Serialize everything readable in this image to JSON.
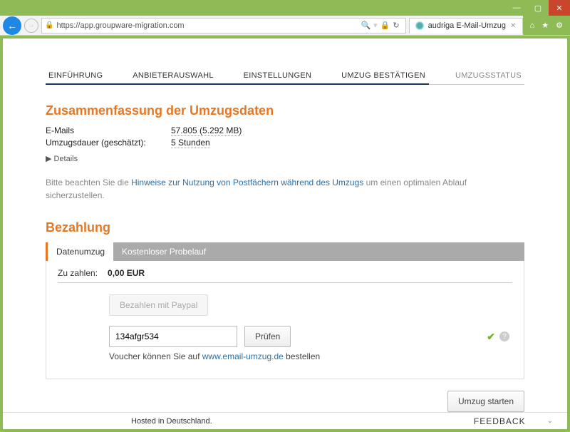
{
  "browser": {
    "url": "https://app.groupware-migration.com",
    "tab_title": "audriga E-Mail-Umzug"
  },
  "steps": {
    "s1": "EINFÜHRUNG",
    "s2": "ANBIETERAUSWAHL",
    "s3": "EINSTELLUNGEN",
    "s4": "UMZUG BESTÄTIGEN",
    "s5": "UMZUGSSTATUS"
  },
  "summary": {
    "title": "Zusammenfassung der Umzugsdaten",
    "emails_label": "E-Mails",
    "emails_value": "57.805 (5.292 MB)",
    "duration_label": "Umzugsdauer (geschätzt):",
    "duration_value": "5 Stunden",
    "details": "Details"
  },
  "note": {
    "pre": "Bitte beachten Sie die ",
    "link": "Hinweise zur Nutzung von Postfächern während des Umzugs",
    "post": " um einen optimalen Ablauf sicherzustellen."
  },
  "payment": {
    "title": "Bezahlung",
    "tab_active": "Datenumzug",
    "tab_inactive": "Kostenloser Probelauf",
    "to_pay_label": "Zu zahlen:",
    "to_pay_value": "0,00 EUR",
    "paypal_btn": "Bezahlen mit Paypal",
    "voucher_value": "134afgr534",
    "check_btn": "Prüfen",
    "voucher_note_pre": "Voucher können Sie auf ",
    "voucher_note_link": "www.email-umzug.de",
    "voucher_note_post": " bestellen"
  },
  "start_btn": "Umzug starten",
  "footer": {
    "hosted": "Hosted in Deutschland.",
    "feedback": "FEEDBACK"
  }
}
